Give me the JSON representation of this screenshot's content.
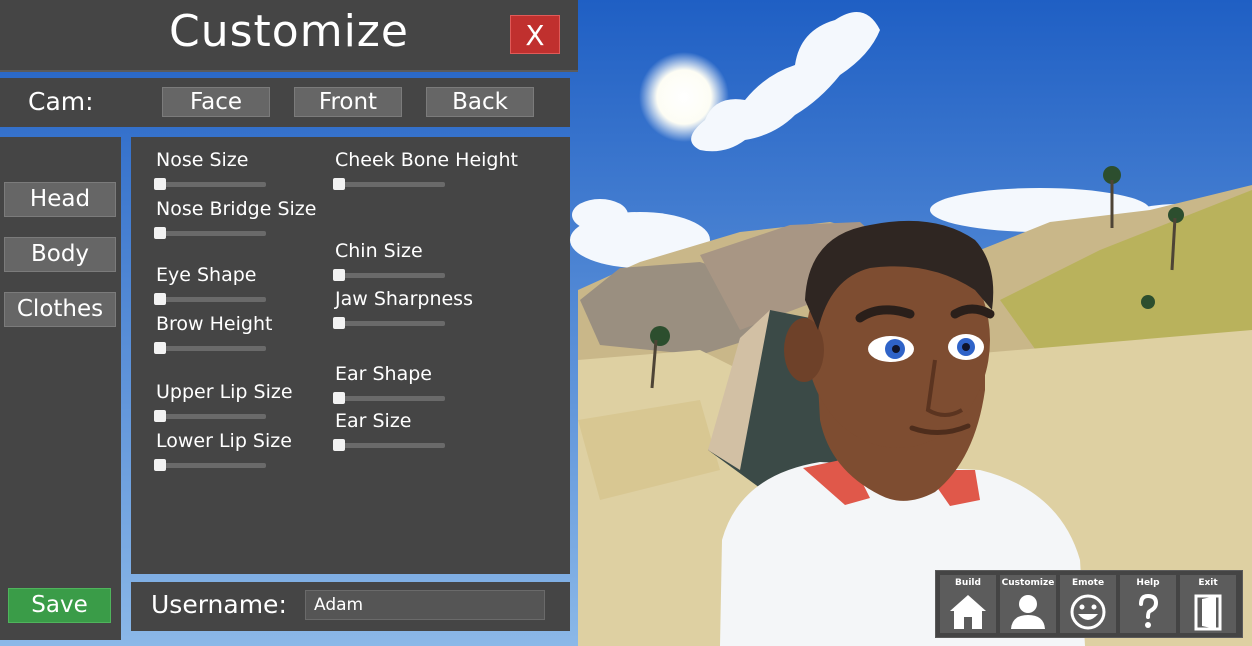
{
  "header": {
    "title": "Customize",
    "close_label": "X"
  },
  "camera": {
    "label": "Cam:",
    "buttons": [
      "Face",
      "Front",
      "Back"
    ]
  },
  "sidebar": {
    "items": [
      "Head",
      "Body",
      "Clothes"
    ],
    "save_label": "Save"
  },
  "sliders": {
    "left": [
      {
        "label": "Nose Size",
        "value": 0
      },
      {
        "label": "Nose Bridge Size",
        "value": 0
      },
      {
        "label": "Eye Shape",
        "value": 0
      },
      {
        "label": "Brow Height",
        "value": 0
      },
      {
        "label": "Upper Lip Size",
        "value": 0
      },
      {
        "label": "Lower Lip Size",
        "value": 0
      }
    ],
    "right": [
      {
        "label": "Cheek Bone Height",
        "value": 0
      },
      {
        "label": "Chin Size",
        "value": 0
      },
      {
        "label": "Jaw Sharpness",
        "value": 0
      },
      {
        "label": "Ear Shape",
        "value": 0
      },
      {
        "label": "Ear Size",
        "value": 0
      }
    ]
  },
  "username": {
    "label": "Username:",
    "value": "Adam"
  },
  "toolbar": {
    "items": [
      {
        "label": "Build",
        "icon": "house-icon"
      },
      {
        "label": "Customize",
        "icon": "person-icon"
      },
      {
        "label": "Emote",
        "icon": "smiley-icon"
      },
      {
        "label": "Help",
        "icon": "question-icon"
      },
      {
        "label": "Exit",
        "icon": "door-icon"
      }
    ]
  },
  "colors": {
    "panel": "#454545",
    "button": "#666666",
    "save": "#3a9c48",
    "close": "#c0302e"
  }
}
